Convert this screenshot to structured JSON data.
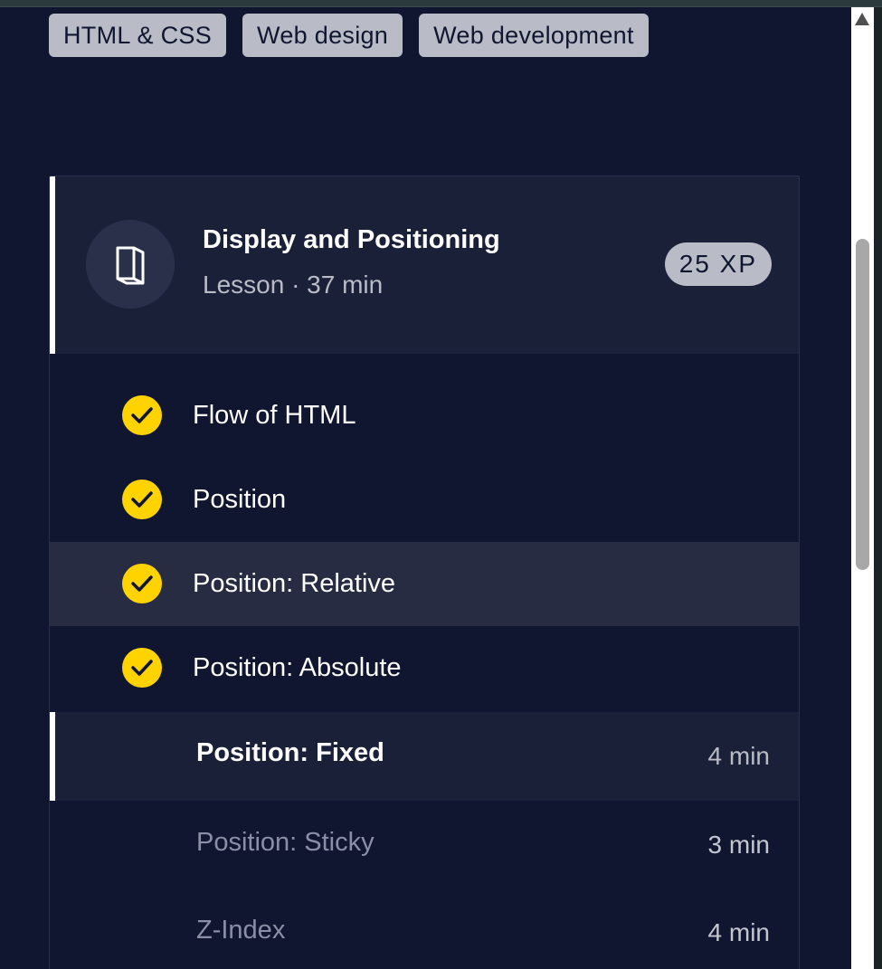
{
  "tags": [
    "HTML & CSS",
    "Web design",
    "Web development"
  ],
  "lesson": {
    "title": "Display and Positioning",
    "meta": "Lesson · 37 min",
    "xp": "25 XP",
    "icon": "book-icon"
  },
  "items": [
    {
      "label": "Flow of HTML",
      "completed": true
    },
    {
      "label": "Position",
      "completed": true
    },
    {
      "label": "Position: Relative",
      "completed": true
    },
    {
      "label": "Position: Absolute",
      "completed": true
    },
    {
      "label": "Position: Fixed",
      "time": "4 min",
      "current": true
    },
    {
      "label": "Position: Sticky",
      "time": "3 min"
    },
    {
      "label": "Z-Index",
      "time": "4 min"
    }
  ],
  "colors": {
    "background": "#10162f",
    "check": "#ffd300",
    "tag": "#b9bcc7"
  }
}
